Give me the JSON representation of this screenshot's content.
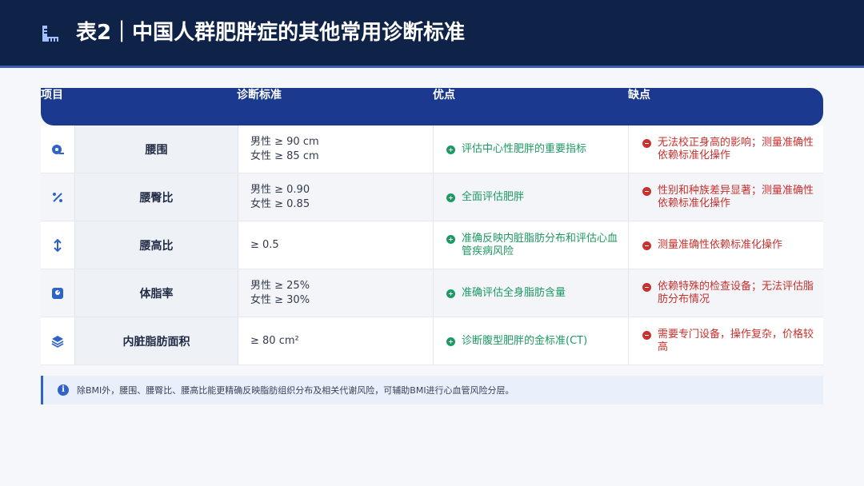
{
  "header": {
    "title": "表2｜中国人群肥胖症的其他常用诊断标准",
    "icon": "ruler-icon"
  },
  "table": {
    "headers": [
      "项目",
      "诊断标准",
      "优点",
      "缺点"
    ],
    "rows": [
      {
        "icon": "tape-measure-icon",
        "name": "腰围",
        "criteria": [
          "男性 ≥ 90 cm",
          "女性 ≥ 85 cm"
        ],
        "pro": "评估中心性肥胖的重要指标",
        "con": "无法校正身高的影响；测量准确性依赖标准化操作"
      },
      {
        "icon": "percent-icon",
        "name": "腰臀比",
        "criteria": [
          "男性 ≥ 0.90",
          "女性 ≥ 0.85"
        ],
        "pro": "全面评估肥胖",
        "con": "性别和种族差异显著；测量准确性依赖标准化操作"
      },
      {
        "icon": "vertical-arrows-icon",
        "name": "腰高比",
        "criteria": [
          "≥ 0.5"
        ],
        "pro": "准确反映内脏脂肪分布和评估心血管疾病风险",
        "con": "测量准确性依赖标准化操作"
      },
      {
        "icon": "scale-icon",
        "name": "体脂率",
        "criteria": [
          "男性 ≥ 25%",
          "女性 ≥ 30%"
        ],
        "pro": "准确评估全身脂肪含量",
        "con": "依赖特殊的检查设备；无法评估脂肪分布情况"
      },
      {
        "icon": "layers-icon",
        "name": "内脏脂肪面积",
        "criteria": [
          "≥ 80 cm²"
        ],
        "pro": "诊断腹型肥胖的金标准(CT)",
        "con": "需要专门设备，操作复杂，价格较高"
      }
    ]
  },
  "note": {
    "icon": "info-icon",
    "text": "除BMI外，腰围、腰臀比、腰高比能更精确反映脂肪组织分布及相关代谢风险，可辅助BMI进行心血管风险分层。"
  },
  "colors": {
    "header_bg": "#0f2248",
    "table_header_bg": "#1b3a8f",
    "pro": "#1d9a62",
    "con": "#c7312e",
    "accent": "#2f63c6"
  }
}
